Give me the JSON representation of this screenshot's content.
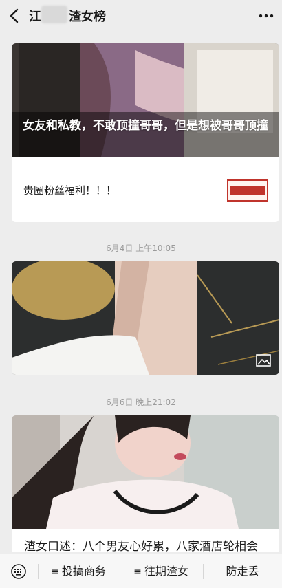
{
  "header": {
    "title": "江",
    "title_suffix": "渣女榜",
    "back_icon": "chevron-left-icon",
    "more_icon": "more-dots-icon"
  },
  "feed": {
    "items": [
      {
        "cover_title": "女友和私教，不敢顶撞哥哥，但是想被哥哥顶撞",
        "sub_title": "贵圈粉丝福利！！！"
      },
      {
        "timestamp": "6月4日 上午10:05",
        "image_icon": "image-icon"
      },
      {
        "timestamp": "6月6日 晚上21:02",
        "title": "渣女口述：八个男友心好累，八家酒店轮相会"
      }
    ]
  },
  "bottom_menu": {
    "keyboard_icon": "keyboard-icon",
    "items": [
      {
        "prefix": "≡",
        "label": "投搞商务"
      },
      {
        "prefix": "≡",
        "label": "往期渣女"
      },
      {
        "label": "防走丢"
      }
    ]
  },
  "colors": {
    "background": "#ededed",
    "card": "#ffffff",
    "timestamp": "#9a9a9a",
    "accent_red": "#c0342c"
  }
}
